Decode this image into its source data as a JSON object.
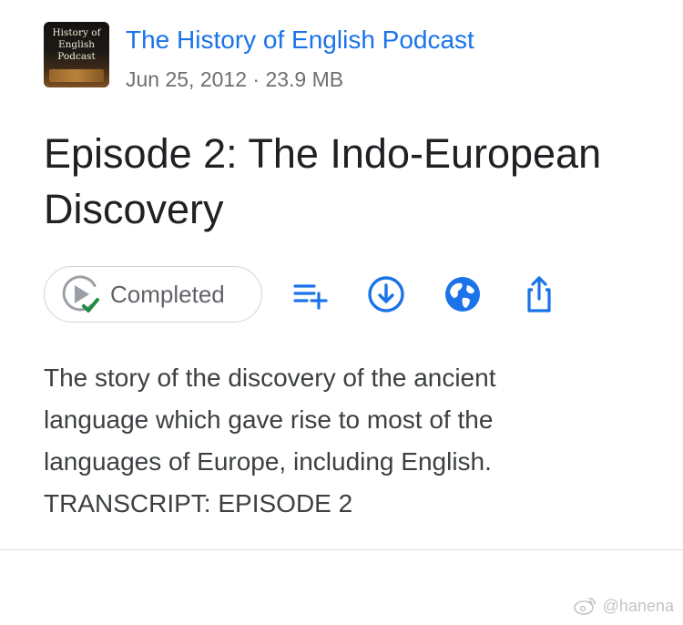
{
  "podcast": {
    "title": "The History of English Podcast",
    "artwork_lines": [
      "History of",
      "English",
      "Podcast"
    ],
    "meta": "Jun 25, 2012 · 23.9 MB"
  },
  "episode": {
    "title": "Episode 2: The Indo-European Discovery",
    "description_lines": [
      "The story of the discovery of the ancient",
      "language which gave rise to most of the",
      "languages of Europe, including English.",
      "TRANSCRIPT: EPISODE 2"
    ]
  },
  "actions": {
    "status_label": "Completed",
    "status_icon": "play-circle-check-icon",
    "buttons": [
      {
        "icon": "add-to-queue-icon"
      },
      {
        "icon": "download-circle-icon"
      },
      {
        "icon": "globe-icon"
      },
      {
        "icon": "share-icon"
      }
    ]
  },
  "watermark": {
    "text": "@hanena",
    "icon": "weibo-icon"
  },
  "colors": {
    "accent": "#1a73e8",
    "check": "#1e8e3e",
    "text_primary": "#202124",
    "text_secondary": "#6f6f6f"
  }
}
